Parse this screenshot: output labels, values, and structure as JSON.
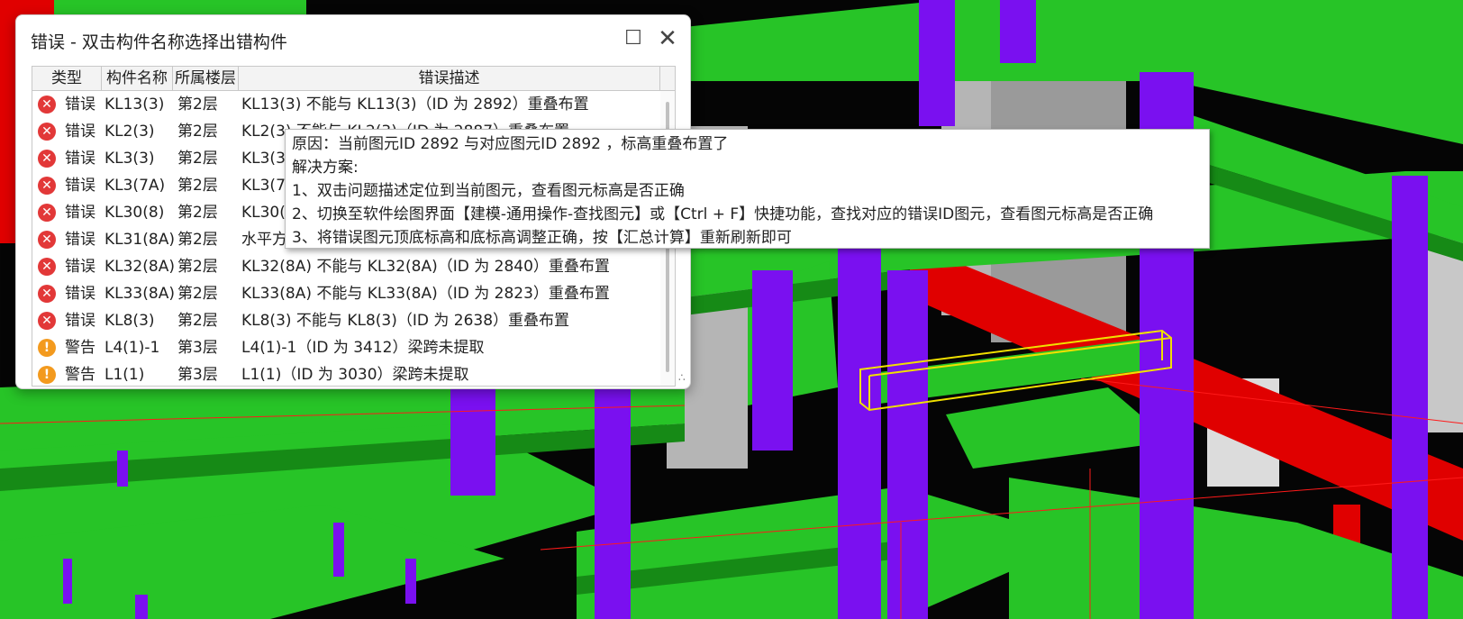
{
  "dialog": {
    "title": "错误 - 双击构件名称选择出错构件",
    "columns": [
      "类型",
      "构件名称",
      "所属楼层",
      "错误描述"
    ],
    "rows": [
      {
        "severity": "error",
        "type": "错误",
        "name": "KL13(3)",
        "floor": "第2层",
        "desc": "KL13(3) 不能与 KL13(3)（ID 为 2892）重叠布置"
      },
      {
        "severity": "error",
        "type": "错误",
        "name": "KL2(3)",
        "floor": "第2层",
        "desc": "KL2(3) 不能与 KL2(3)（ID 为 2887）重叠布置"
      },
      {
        "severity": "error",
        "type": "错误",
        "name": "KL3(3)",
        "floor": "第2层",
        "desc": "KL3(3)"
      },
      {
        "severity": "error",
        "type": "错误",
        "name": "KL3(7A)",
        "floor": "第2层",
        "desc": "KL3(7A)"
      },
      {
        "severity": "error",
        "type": "错误",
        "name": "KL30(8)",
        "floor": "第2层",
        "desc": "KL30(8)"
      },
      {
        "severity": "error",
        "type": "错误",
        "name": "KL31(8A)",
        "floor": "第2层",
        "desc": "水平方向"
      },
      {
        "severity": "error",
        "type": "错误",
        "name": "KL32(8A)",
        "floor": "第2层",
        "desc": "KL32(8A) 不能与 KL32(8A)（ID 为 2840）重叠布置"
      },
      {
        "severity": "error",
        "type": "错误",
        "name": "KL33(8A)",
        "floor": "第2层",
        "desc": "KL33(8A) 不能与 KL33(8A)（ID 为 2823）重叠布置"
      },
      {
        "severity": "error",
        "type": "错误",
        "name": "KL8(3)",
        "floor": "第2层",
        "desc": "KL8(3) 不能与 KL8(3)（ID 为 2638）重叠布置"
      },
      {
        "severity": "warning",
        "type": "警告",
        "name": "L4(1)-1",
        "floor": "第3层",
        "desc": "L4(1)-1（ID 为 3412）梁跨未提取"
      },
      {
        "severity": "warning",
        "type": "警告",
        "name": "L1(1)",
        "floor": "第3层",
        "desc": "L1(1)（ID 为 3030）梁跨未提取"
      }
    ]
  },
  "tooltip": {
    "lines": [
      "原因：当前图元ID 2892 与对应图元ID 2892 ，标高重叠布置了",
      "解决方案:",
      "1、双击问题描述定位到当前图元，查看图元标高是否正确",
      "2、切换至软件绘图界面【建模-通用操作-查找图元】或【Ctrl + F】快捷功能，查找对应的错误ID图元，查看图元标高是否正确",
      "3、将错误图元顶底标高和底标高调整正确，按【汇总计算】重新刷新即可"
    ]
  },
  "colors": {
    "beam_green": "#2ec82e",
    "column_purple": "#7a10f0",
    "error_beam_red": "#e00000",
    "selection_yellow": "#f0e000",
    "wall_gray": "#b8b8b8"
  }
}
